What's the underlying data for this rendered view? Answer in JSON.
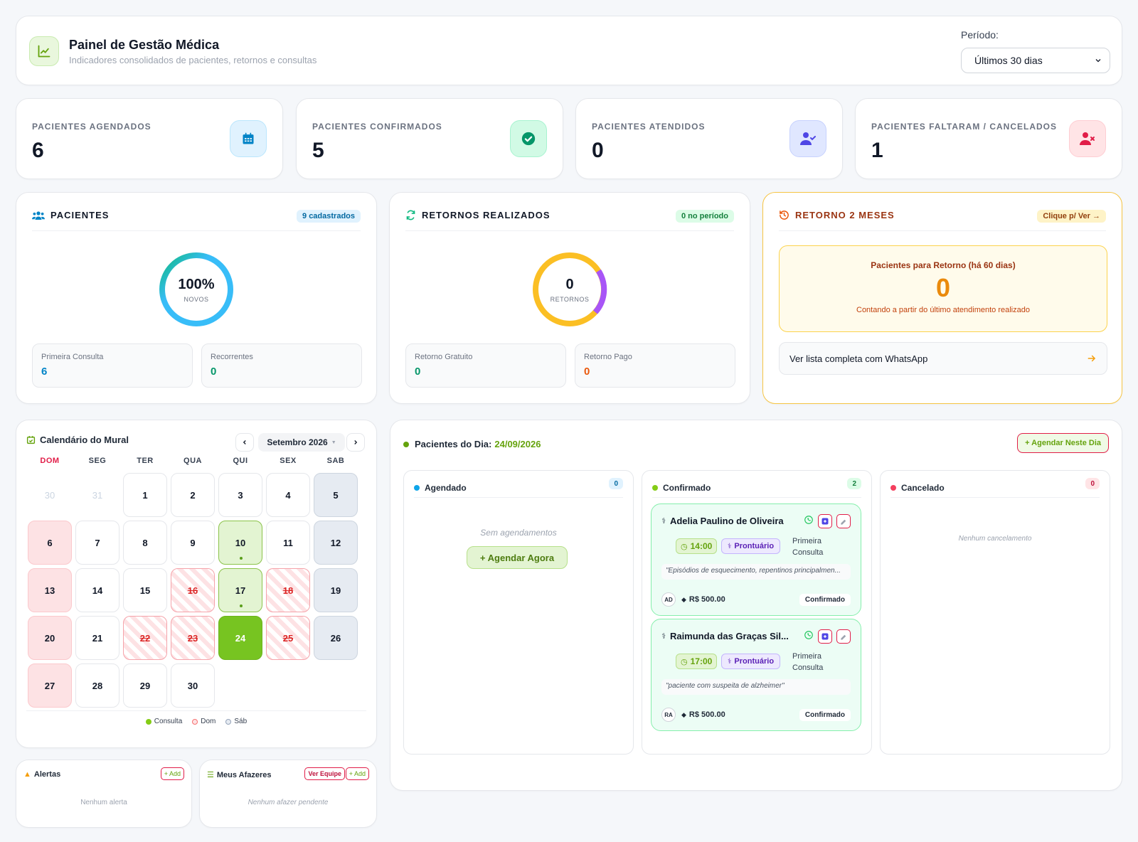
{
  "header": {
    "title": "Painel de Gestão Médica",
    "subtitle": "Indicadores consolidados de pacientes, retornos e consultas",
    "period_label": "Período:",
    "period_value": "Últimos 30 dias",
    "icon": "chart-line-icon"
  },
  "stats": [
    {
      "label": "PACIENTES AGENDADOS",
      "value": "6",
      "icon": "calendar-icon",
      "color": "#0284c7",
      "bg": "#e0f2fe"
    },
    {
      "label": "PACIENTES CONFIRMADOS",
      "value": "5",
      "icon": "check-circle-icon",
      "color": "#059669",
      "bg": "#d1fae5"
    },
    {
      "label": "PACIENTES ATENDIDOS",
      "value": "0",
      "icon": "user-check-icon",
      "color": "#4f46e5",
      "bg": "#e0e7ff"
    },
    {
      "label": "PACIENTES FALTARAM / CANCELADOS",
      "value": "1",
      "icon": "user-x-icon",
      "color": "#e11d48",
      "bg": "#ffe4e6"
    }
  ],
  "pacientes": {
    "title": "PACIENTES",
    "badge": "9 cadastrados",
    "ring_value": "100%",
    "ring_label": "NOVOS",
    "first_label": "Primeira Consulta",
    "first_value": "6",
    "rec_label": "Recorrentes",
    "rec_value": "0"
  },
  "retornos": {
    "title": "RETORNOS REALIZADOS",
    "badge": "0 no período",
    "ring_value": "0",
    "ring_label": "RETORNOS",
    "free_label": "Retorno Gratuito",
    "free_value": "0",
    "paid_label": "Retorno Pago",
    "paid_value": "0"
  },
  "retorno2m": {
    "title": "RETORNO 2 MESES",
    "badge": "Clique p/ Ver →",
    "box_title": "Pacientes para Retorno (há 60 dias)",
    "box_value": "0",
    "box_note": "Contando a partir do último atendimento realizado",
    "link": "Ver lista completa com WhatsApp"
  },
  "calendar": {
    "title": "Calendário do Mural",
    "month": "Setembro 2026",
    "weekdays": [
      "DOM",
      "SEG",
      "TER",
      "QUA",
      "QUI",
      "SEX",
      "SAB"
    ],
    "days": [
      {
        "d": "30",
        "t": "out"
      },
      {
        "d": "31",
        "t": "out"
      },
      {
        "d": "1",
        "t": ""
      },
      {
        "d": "2",
        "t": ""
      },
      {
        "d": "3",
        "t": ""
      },
      {
        "d": "4",
        "t": ""
      },
      {
        "d": "5",
        "t": "sat"
      },
      {
        "d": "6",
        "t": "sun"
      },
      {
        "d": "7",
        "t": ""
      },
      {
        "d": "8",
        "t": ""
      },
      {
        "d": "9",
        "t": ""
      },
      {
        "d": "10",
        "t": "cons"
      },
      {
        "d": "11",
        "t": ""
      },
      {
        "d": "12",
        "t": "sat"
      },
      {
        "d": "13",
        "t": "sun"
      },
      {
        "d": "14",
        "t": ""
      },
      {
        "d": "15",
        "t": ""
      },
      {
        "d": "16",
        "t": "hol"
      },
      {
        "d": "17",
        "t": "cons"
      },
      {
        "d": "18",
        "t": "hol"
      },
      {
        "d": "19",
        "t": "sat"
      },
      {
        "d": "20",
        "t": "sun"
      },
      {
        "d": "21",
        "t": ""
      },
      {
        "d": "22",
        "t": "hol"
      },
      {
        "d": "23",
        "t": "hol"
      },
      {
        "d": "24",
        "t": "today"
      },
      {
        "d": "25",
        "t": "hol"
      },
      {
        "d": "26",
        "t": "sat"
      },
      {
        "d": "27",
        "t": "sun"
      },
      {
        "d": "28",
        "t": ""
      },
      {
        "d": "29",
        "t": ""
      },
      {
        "d": "30",
        "t": ""
      }
    ],
    "legend": [
      "Consulta",
      "Dom",
      "Sáb"
    ]
  },
  "alertas": {
    "title": "Alertas",
    "add": "+ Add",
    "empty": "Nenhum alerta"
  },
  "afazeres": {
    "title": "Meus Afazeres",
    "team": "Ver Equipe",
    "add": "+ Add",
    "empty": "Nenhum afazer pendente"
  },
  "dia": {
    "title": "Pacientes do Dia:",
    "date": "24/09/2026",
    "button": "+ Agendar Neste Dia",
    "cols": [
      {
        "name": "Agendado",
        "count": "0",
        "color": "#0ea5e9",
        "empty": "Sem agendamentos",
        "cta": "+ Agendar Agora"
      },
      {
        "name": "Confirmado",
        "count": "2",
        "color": "#84cc16"
      },
      {
        "name": "Cancelado",
        "count": "0",
        "color": "#f43f5e",
        "empty": "Nenhum cancelamento"
      }
    ],
    "appts": [
      {
        "name": "Adelia Paulino de Oliveira",
        "time": "14:00",
        "pront": "Prontuário",
        "type": "Primeira Consulta",
        "note": "\"Episódios de esquecimento, repentinos principalmen...",
        "initials": "AD",
        "price": "R$ 500.00",
        "status": "Confirmado"
      },
      {
        "name": "Raimunda das Graças Sil...",
        "time": "17:00",
        "pront": "Prontuário",
        "type": "Primeira Consulta",
        "note": "\"paciente com suspeita de alzheimer\"",
        "initials": "RA",
        "price": "R$ 500.00",
        "status": "Confirmado"
      }
    ]
  }
}
